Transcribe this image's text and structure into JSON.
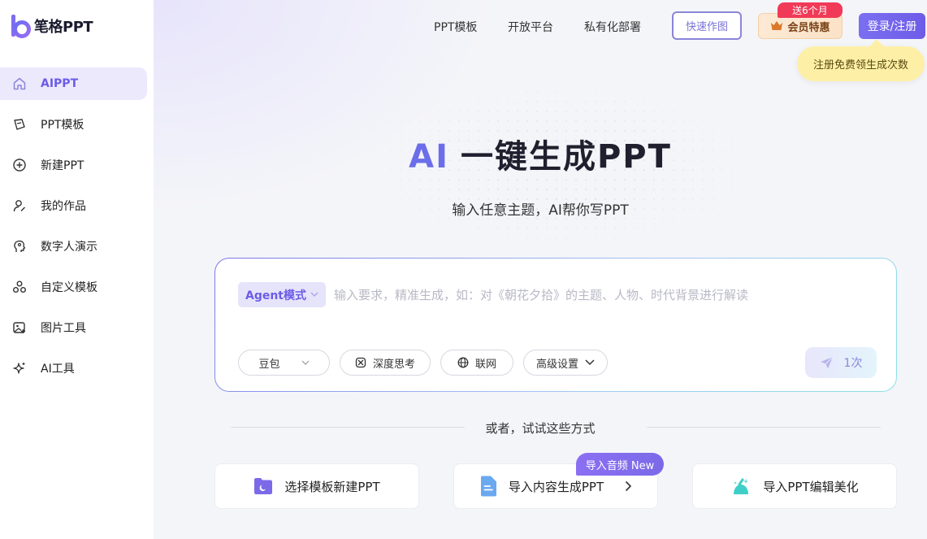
{
  "brand": {
    "name": "笔格PPT"
  },
  "sidebar": {
    "items": [
      {
        "label": "AIPPT",
        "icon": "home-icon"
      },
      {
        "label": "PPT模板",
        "icon": "template-icon"
      },
      {
        "label": "新建PPT",
        "icon": "plus-circle-icon"
      },
      {
        "label": "我的作品",
        "icon": "user-edit-icon"
      },
      {
        "label": "数字人演示",
        "icon": "digital-human-icon"
      },
      {
        "label": "自定义模板",
        "icon": "custom-template-icon"
      },
      {
        "label": "图片工具",
        "icon": "image-tool-icon"
      },
      {
        "label": "AI工具",
        "icon": "sparkle-icon"
      }
    ]
  },
  "header": {
    "nav": [
      "PPT模板",
      "开放平台",
      "私有化部署"
    ],
    "quick_label": "快速作图",
    "vip_label": "会员特惠",
    "vip_badge": "送6个月",
    "login_label": "登录/注册",
    "tip": "注册免费领生成次数"
  },
  "hero": {
    "title_ai": "AI",
    "title_rest": "一键生成PPT",
    "subtitle": "输入任意主题，AI帮你写PPT"
  },
  "input": {
    "mode": "Agent模式",
    "placeholder": "输入要求，精准生成，如：对《朝花夕拾》的主题、人物、时代背景进行解读",
    "model": "豆包",
    "deep_think": "深度思考",
    "web": "联网",
    "advanced": "高级设置",
    "send_count": "1次"
  },
  "alt": {
    "divider": "或者，试试这些方式",
    "options": [
      "选择模板新建PPT",
      "导入内容生成PPT",
      "导入PPT编辑美化"
    ],
    "new_badge": "导入音频 New"
  },
  "colors": {
    "accent": "#6b5ce7",
    "red_badge": "#f03a57",
    "tip_bg": "#fdf0a6"
  }
}
